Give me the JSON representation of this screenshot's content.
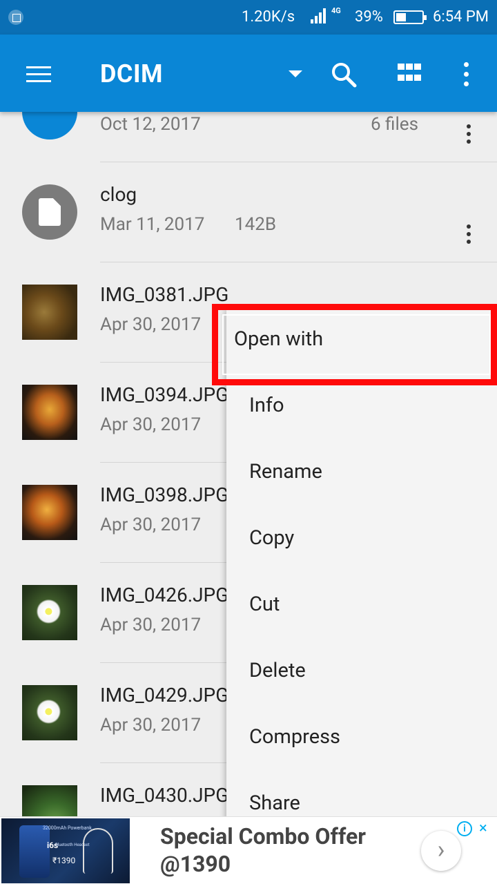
{
  "status_bar": {
    "speed": "1.20K/s",
    "network": "4G",
    "battery_pct": "39%",
    "battery_level": 0.39,
    "time": "6:54 PM"
  },
  "app_bar": {
    "title": "DCIM",
    "icons": [
      "menu-icon",
      "dropdown-icon",
      "search-icon",
      "grid-view-icon",
      "overflow-icon"
    ]
  },
  "files": [
    {
      "name": "",
      "date": "Oct 12, 2017",
      "size": "6 files",
      "type": "folder"
    },
    {
      "name": "clog",
      "date": "Mar 11, 2017",
      "size": "142B",
      "type": "file"
    },
    {
      "name": "IMG_0381.JPG",
      "date": "Apr 30, 2017",
      "size": "",
      "type": "image"
    },
    {
      "name": "IMG_0394.JPG",
      "date": "Apr 30, 2017",
      "size": "",
      "type": "image"
    },
    {
      "name": "IMG_0398.JPG",
      "date": "Apr 30, 2017",
      "size": "",
      "type": "image"
    },
    {
      "name": "IMG_0426.JPG",
      "date": "Apr 30, 2017",
      "size": "",
      "type": "image"
    },
    {
      "name": "IMG_0429.JPG",
      "date": "Apr 30, 2017",
      "size": "",
      "type": "image"
    },
    {
      "name": "IMG_0430.JPG",
      "date": "",
      "size": "",
      "type": "image"
    }
  ],
  "context_menu": {
    "items": [
      "Open with",
      "Info",
      "Rename",
      "Copy",
      "Cut",
      "Delete",
      "Compress",
      "Share"
    ],
    "highlighted": "Open with"
  },
  "ad": {
    "text": "Special Combo Offer @1390",
    "image_text1": "32000mAh Powerbank",
    "image_text2": "i6s",
    "image_text3": "Bluetooth Headset",
    "image_price": "₹1390",
    "arrow": "›",
    "info": "i",
    "close": "×"
  },
  "colors": {
    "app_bar": "#0a86d6",
    "status_bar": "#0a6fb5",
    "highlight": "#ff0a0a"
  }
}
